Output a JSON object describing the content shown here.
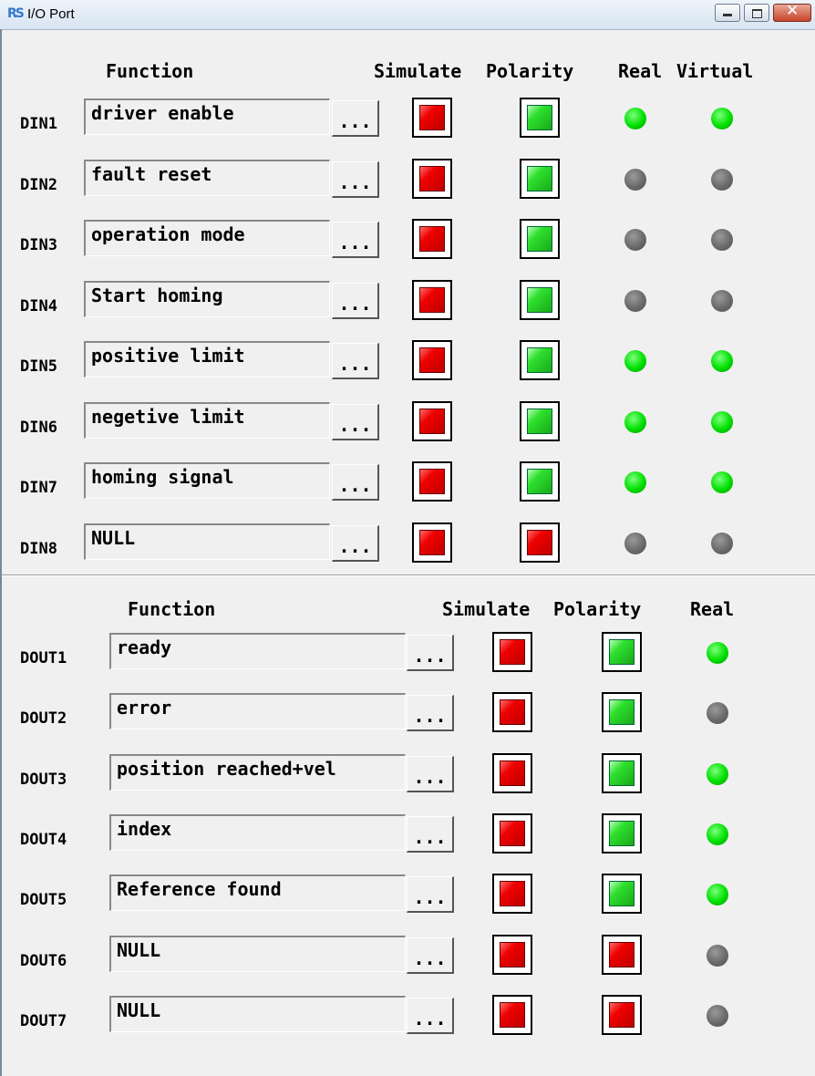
{
  "window": {
    "title": "I/O Port",
    "icon": "app-logo-icon",
    "app_icon_text": "RS"
  },
  "inputs": {
    "headers": {
      "function": "Function",
      "simulate": "Simulate",
      "polarity": "Polarity",
      "real": "Real",
      "virtual": "Virtual"
    },
    "rows": [
      {
        "label": "DIN1",
        "function": "driver enable",
        "button": "...",
        "simulate": "red",
        "polarity": "green",
        "real": "on",
        "virtual": "on"
      },
      {
        "label": "DIN2",
        "function": "fault reset",
        "button": "...",
        "simulate": "red",
        "polarity": "green",
        "real": "off",
        "virtual": "off"
      },
      {
        "label": "DIN3",
        "function": "operation mode",
        "button": "...",
        "simulate": "red",
        "polarity": "green",
        "real": "off",
        "virtual": "off"
      },
      {
        "label": "DIN4",
        "function": "Start homing",
        "button": "...",
        "simulate": "red",
        "polarity": "green",
        "real": "off",
        "virtual": "off"
      },
      {
        "label": "DIN5",
        "function": "positive limit",
        "button": "...",
        "simulate": "red",
        "polarity": "green",
        "real": "on",
        "virtual": "on"
      },
      {
        "label": "DIN6",
        "function": "negetive limit",
        "button": "...",
        "simulate": "red",
        "polarity": "green",
        "real": "on",
        "virtual": "on"
      },
      {
        "label": "DIN7",
        "function": "homing signal",
        "button": "...",
        "simulate": "red",
        "polarity": "green",
        "real": "on",
        "virtual": "on"
      },
      {
        "label": "DIN8",
        "function": "NULL",
        "button": "...",
        "simulate": "red",
        "polarity": "red",
        "real": "off",
        "virtual": "off"
      }
    ]
  },
  "outputs": {
    "headers": {
      "function": "Function",
      "simulate": "Simulate",
      "polarity": "Polarity",
      "real": "Real"
    },
    "rows": [
      {
        "label": "DOUT1",
        "function": "ready",
        "button": "...",
        "simulate": "red",
        "polarity": "green",
        "real": "on"
      },
      {
        "label": "DOUT2",
        "function": "error",
        "button": "...",
        "simulate": "red",
        "polarity": "green",
        "real": "off"
      },
      {
        "label": "DOUT3",
        "function": "position reached+vel",
        "button": "...",
        "simulate": "red",
        "polarity": "green",
        "real": "on"
      },
      {
        "label": "DOUT4",
        "function": "index",
        "button": "...",
        "simulate": "red",
        "polarity": "green",
        "real": "on"
      },
      {
        "label": "DOUT5",
        "function": "Reference found",
        "button": "...",
        "simulate": "red",
        "polarity": "green",
        "real": "on"
      },
      {
        "label": "DOUT6",
        "function": "NULL",
        "button": "...",
        "simulate": "red",
        "polarity": "red",
        "real": "off"
      },
      {
        "label": "DOUT7",
        "function": "NULL",
        "button": "...",
        "simulate": "red",
        "polarity": "red",
        "real": "off"
      }
    ]
  },
  "colors": {
    "led_on": "#00e000",
    "led_off": "#6a6a6a",
    "button_red": "#ee0000",
    "button_green": "#2ee02e"
  }
}
